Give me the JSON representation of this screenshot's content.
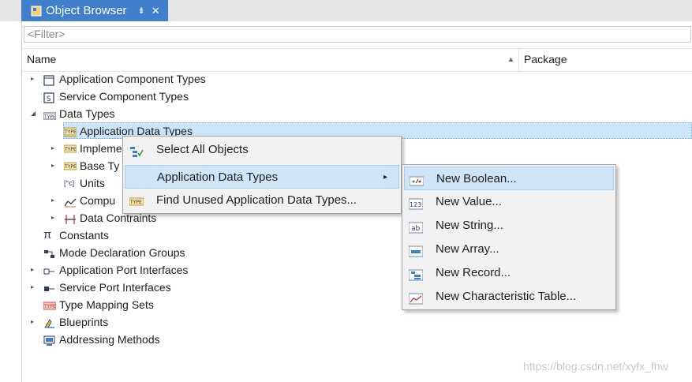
{
  "tab": {
    "title": "Object Browser",
    "pin": "⇟",
    "close": "✕"
  },
  "filter": {
    "placeholder": "<Filter>"
  },
  "columns": {
    "name": "Name",
    "package": "Package",
    "sort": "▲"
  },
  "tree": [
    {
      "label": "Application Component Types",
      "expander": "▸"
    },
    {
      "label": "Service Component Types",
      "expander": ""
    },
    {
      "label": "Data Types",
      "expander": "◢"
    },
    {
      "label": "Application Data Types",
      "expander": ""
    },
    {
      "label": "Impleme",
      "expander": "▸"
    },
    {
      "label": "Base Ty",
      "expander": "▸"
    },
    {
      "label": "Units",
      "expander": ""
    },
    {
      "label": "Compu",
      "expander": "▸"
    },
    {
      "label": "Data Contraints",
      "expander": "▸"
    },
    {
      "label": "Constants",
      "expander": ""
    },
    {
      "label": "Mode Declaration Groups",
      "expander": ""
    },
    {
      "label": "Application Port Interfaces",
      "expander": "▸"
    },
    {
      "label": "Service Port Interfaces",
      "expander": "▸"
    },
    {
      "label": "Type Mapping Sets",
      "expander": ""
    },
    {
      "label": "Blueprints",
      "expander": "▸"
    },
    {
      "label": "Addressing Methods",
      "expander": ""
    }
  ],
  "context_menu": {
    "items": [
      {
        "label": "Select All Objects"
      },
      {
        "label": "Application Data Types",
        "submenu": "▸"
      },
      {
        "label": "Find Unused Application Data Types..."
      }
    ]
  },
  "submenu": {
    "items": [
      {
        "label": "New Boolean..."
      },
      {
        "label": "New Value..."
      },
      {
        "label": "New String..."
      },
      {
        "label": "New Array..."
      },
      {
        "label": "New Record..."
      },
      {
        "label": "New Characteristic Table..."
      }
    ]
  },
  "watermark": "https://blog.csdn.net/xyfx_fhw",
  "colors": {
    "tab_active": "#3f7fcc",
    "selection": "#cce4f7",
    "menu_bg": "#f2f2f2"
  }
}
